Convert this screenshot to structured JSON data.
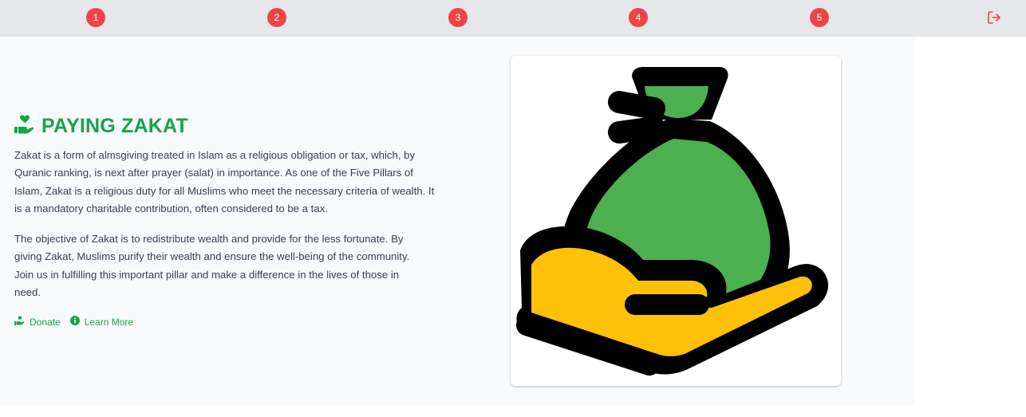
{
  "steps": [
    "1",
    "2",
    "3",
    "4",
    "5"
  ],
  "icons": {
    "logout": "logout-icon",
    "title": "hand-holding-heart-icon",
    "donate": "hand-holding-icon",
    "learn_more": "info-circle-icon",
    "illustration": "money-bag-on-hand"
  },
  "colors": {
    "accent": "#16a34a",
    "step_badge": "#ef4444",
    "bag": "#4caf50",
    "hand": "#ffc107"
  },
  "content": {
    "title": "PAYING ZAKAT",
    "paragraph1": "Zakat is a form of almsgiving treated in Islam as a religious obligation or tax, which, by Quranic ranking, is next after prayer (salat) in importance. As one of the Five Pillars of Islam, Zakat is a religious duty for all Muslims who meet the necessary criteria of wealth. It is a mandatory charitable contribution, often considered to be a tax.",
    "paragraph2": "The objective of Zakat is to redistribute wealth and provide for the less fortunate. By giving Zakat, Muslims purify their wealth and ensure the well-being of the community. Join us in fulfilling this important pillar and make a difference in the lives of those in need.",
    "donate_label": "Donate",
    "learn_more_label": "Learn More"
  }
}
